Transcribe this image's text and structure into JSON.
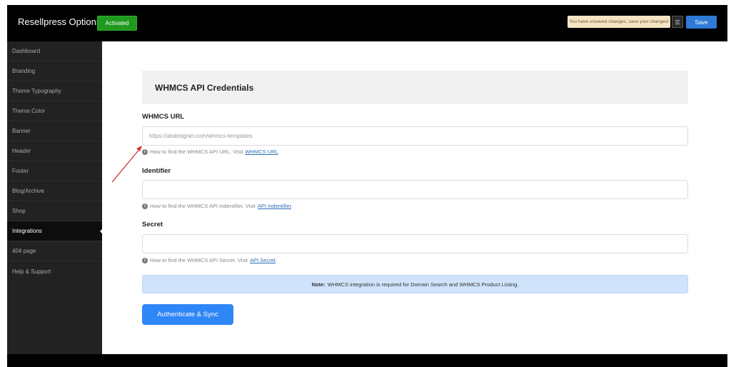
{
  "header": {
    "title": "Resellpress Options",
    "status_badge": "Activated",
    "unsaved_notice": "You have unsaved changes, save your changes!",
    "save_label": "Save"
  },
  "sidebar": {
    "items": [
      {
        "label": "Dashboard"
      },
      {
        "label": "Branding"
      },
      {
        "label": "Theme Typography"
      },
      {
        "label": "Theme Color"
      },
      {
        "label": "Banner"
      },
      {
        "label": "Header"
      },
      {
        "label": "Footer"
      },
      {
        "label": "Blog/Archive"
      },
      {
        "label": "Shop"
      },
      {
        "label": "Integrations",
        "active": true
      },
      {
        "label": "404 page"
      },
      {
        "label": "Help & Support"
      }
    ]
  },
  "main": {
    "section_title": "WHMCS API Credentials",
    "fields": {
      "url": {
        "label": "WHMCS URL",
        "placeholder": "https://akdesigner.com/whmcs-templates",
        "value": "",
        "help_text": "How to find the WHMCS API URL. Visit",
        "help_link": "WHMCS URL"
      },
      "identifier": {
        "label": "Identifier",
        "placeholder": "",
        "value": "",
        "help_text": "How to find the WHMCS API Indentifier. Visit",
        "help_link": "API Indentifier"
      },
      "secret": {
        "label": "Secret",
        "placeholder": "",
        "value": "",
        "help_text": "How to find the WHMCS API Secret. Visit",
        "help_link": "API Secret"
      }
    },
    "note": {
      "prefix": "Note:",
      "text": "WHMCS integration is required for Domain Search and WHMCS Product Listing."
    },
    "auth_button": "Authenticate & Sync"
  },
  "colors": {
    "accent": "#2f86f6",
    "activated": "#1f9a1f",
    "annotation_arrow": "#d32f2f"
  }
}
